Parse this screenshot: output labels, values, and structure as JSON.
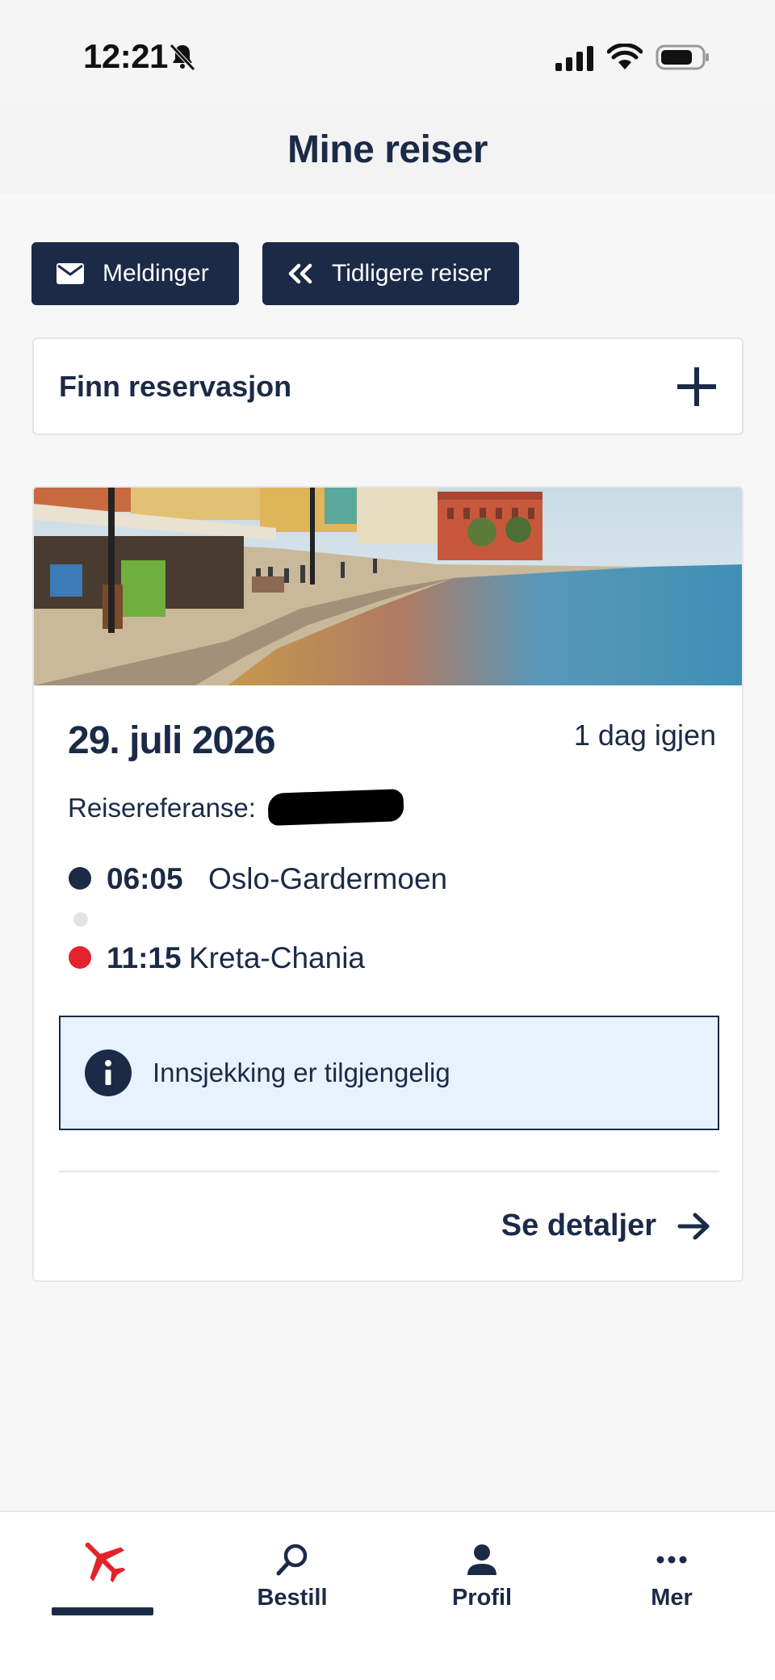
{
  "status_bar": {
    "time": "12:21",
    "icons": [
      "bell-muted-icon",
      "signal-icon",
      "wifi-icon",
      "battery-icon"
    ]
  },
  "header": {
    "title": "Mine reiser"
  },
  "actions": {
    "messages_label": "Meldinger",
    "messages_icon": "envelope-icon",
    "previous_label": "Tidligere reiser",
    "previous_icon": "double-chevron-left-icon"
  },
  "find_reservation": {
    "label": "Finn reservasjon",
    "icon": "plus-icon"
  },
  "trip": {
    "image": "harbor-photo",
    "date": "29. juli 2026",
    "days_left": "1 dag igjen",
    "reference_label": "Reisereferanse:",
    "departure": {
      "time": "06:05",
      "place": "Oslo-Gardermoen"
    },
    "arrival": {
      "time": "11:15",
      "place": "Kreta-Chania"
    },
    "info": {
      "text": "Innsjekking er tilgjengelig",
      "icon": "info-icon"
    },
    "details_label": "Se detaljer",
    "details_icon": "arrow-right-icon"
  },
  "tabs": [
    {
      "label": "",
      "icon": "airplane-icon",
      "active": true
    },
    {
      "label": "Bestill",
      "icon": "search-icon",
      "active": false
    },
    {
      "label": "Profil",
      "icon": "person-icon",
      "active": false
    },
    {
      "label": "Mer",
      "icon": "more-dots-icon",
      "active": false
    }
  ],
  "colors": {
    "navy": "#1b2a47",
    "accent_red": "#e3222c",
    "info_bg": "#e8f2fe",
    "page_bg": "#f7f7f8"
  }
}
